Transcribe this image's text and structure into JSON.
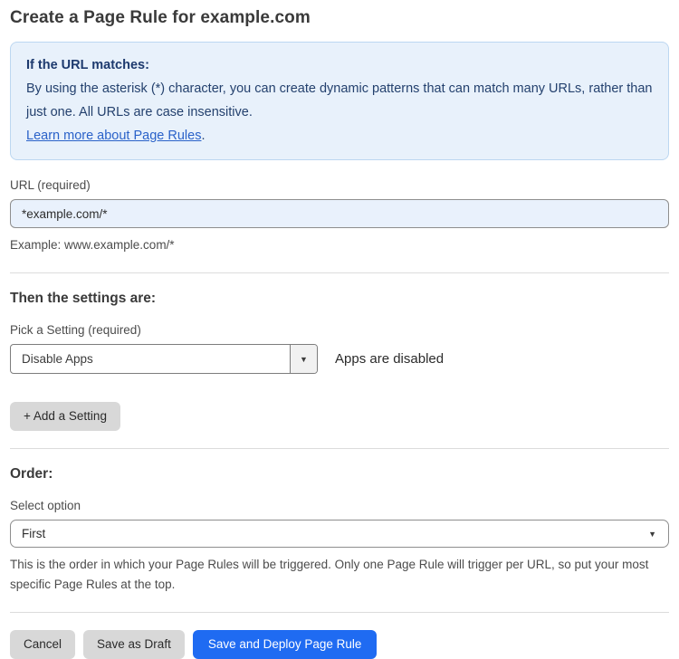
{
  "page": {
    "title": "Create a Page Rule for example.com"
  },
  "info_box": {
    "heading": "If the URL matches:",
    "body": "By using the asterisk (*) character, you can create dynamic patterns that can match many URLs, rather than just one. All URLs are case insensitive.",
    "link_label": "Learn more about Page Rules",
    "link_suffix": "."
  },
  "url_field": {
    "label": "URL (required)",
    "value": "*example.com/*",
    "helper": "Example: www.example.com/*"
  },
  "settings_section": {
    "heading": "Then the settings are:",
    "picker_label": "Pick a Setting (required)",
    "picker_value": "Disable Apps",
    "status_text": "Apps are disabled",
    "add_button_label": "+ Add a Setting"
  },
  "order_section": {
    "heading": "Order:",
    "select_label": "Select option",
    "select_value": "First",
    "helper": "This is the order in which your Page Rules will be triggered. Only one Page Rule will trigger per URL, so put your most specific Page Rules at the top."
  },
  "footer": {
    "cancel_label": "Cancel",
    "save_draft_label": "Save as Draft",
    "save_deploy_label": "Save and Deploy Page Rule"
  },
  "icons": {
    "dropdown_caret": "▼"
  },
  "colors": {
    "accent_blue": "#1f6bf2",
    "info_box_bg": "#e8f1fb",
    "info_box_border": "#bcd7f1",
    "info_text": "#24416e",
    "link_blue": "#2a62c9",
    "input_bg": "#e9f1fc",
    "gray_button_bg": "#d8d8d8"
  }
}
